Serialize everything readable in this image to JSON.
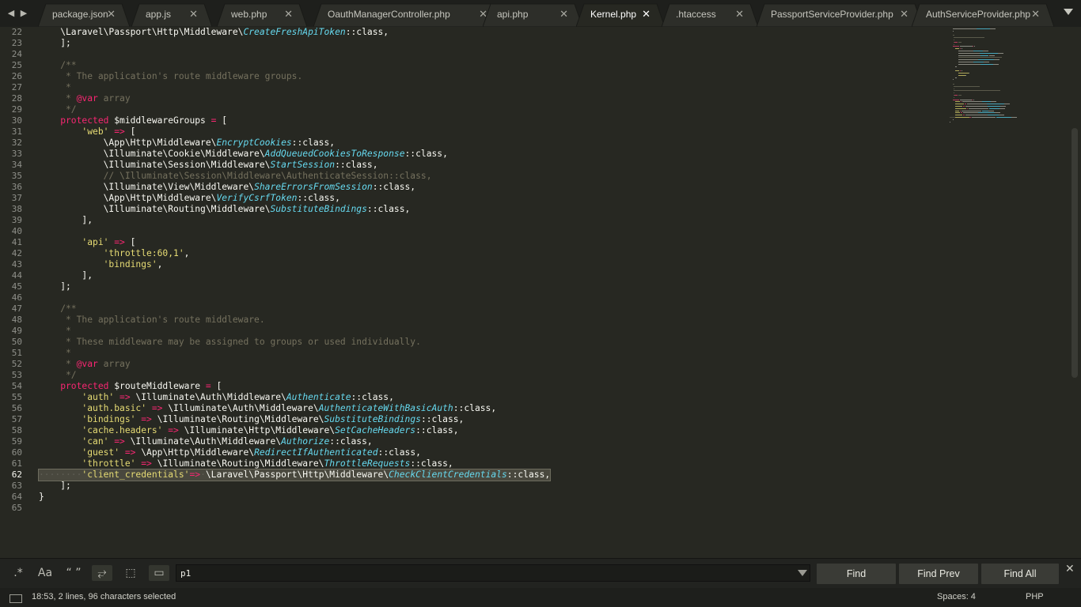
{
  "tabs": [
    {
      "label": "package.json",
      "active": false
    },
    {
      "label": "app.js",
      "active": false
    },
    {
      "label": "web.php",
      "active": false
    },
    {
      "label": "OauthManagerController.php",
      "active": false
    },
    {
      "label": "api.php",
      "active": false
    },
    {
      "label": "Kernel.php",
      "active": true
    },
    {
      "label": ".htaccess",
      "active": false
    },
    {
      "label": "PassportServiceProvider.php",
      "active": false
    },
    {
      "label": "AuthServiceProvider.php",
      "active": false
    }
  ],
  "tab_close_glyph": "✕",
  "nav_back_glyph": "◀",
  "nav_forward_glyph": "▶",
  "editor": {
    "first_line_number": 22,
    "current_line": 62,
    "selected_lines": [
      62
    ],
    "lines": [
      [
        [
          "",
          "    \\Laravel\\Passport\\Http\\Middleware\\"
        ],
        [
          "cl",
          "CreateFreshApiToken"
        ],
        [
          "",
          "::class,"
        ]
      ],
      [
        [
          "",
          "    ];"
        ]
      ],
      [
        [
          "",
          ""
        ]
      ],
      [
        [
          "cm",
          "    /**"
        ]
      ],
      [
        [
          "cm",
          "     * The application's route middleware groups."
        ]
      ],
      [
        [
          "cm",
          "     *"
        ]
      ],
      [
        [
          "cm",
          "     * "
        ],
        [
          "kw",
          "@var"
        ],
        [
          "cm",
          " array"
        ]
      ],
      [
        [
          "cm",
          "     */"
        ]
      ],
      [
        [
          "kw",
          "    protected"
        ],
        [
          "",
          " $middlewareGroups "
        ],
        [
          "kw",
          "="
        ],
        [
          "",
          " ["
        ]
      ],
      [
        [
          "st",
          "        'web'"
        ],
        [
          "kw",
          " =>"
        ],
        [
          "",
          " ["
        ]
      ],
      [
        [
          "",
          "            \\App\\Http\\Middleware\\"
        ],
        [
          "cl",
          "EncryptCookies"
        ],
        [
          "",
          "::class,"
        ]
      ],
      [
        [
          "",
          "            \\Illuminate\\Cookie\\Middleware\\"
        ],
        [
          "cl",
          "AddQueuedCookiesToResponse"
        ],
        [
          "",
          "::class,"
        ]
      ],
      [
        [
          "",
          "            \\Illuminate\\Session\\Middleware\\"
        ],
        [
          "cl",
          "StartSession"
        ],
        [
          "",
          "::class,"
        ]
      ],
      [
        [
          "cm",
          "            // \\Illuminate\\Session\\Middleware\\AuthenticateSession::class,"
        ]
      ],
      [
        [
          "",
          "            \\Illuminate\\View\\Middleware\\"
        ],
        [
          "cl",
          "ShareErrorsFromSession"
        ],
        [
          "",
          "::class,"
        ]
      ],
      [
        [
          "",
          "            \\App\\Http\\Middleware\\"
        ],
        [
          "cl",
          "VerifyCsrfToken"
        ],
        [
          "",
          "::class,"
        ]
      ],
      [
        [
          "",
          "            \\Illuminate\\Routing\\Middleware\\"
        ],
        [
          "cl",
          "SubstituteBindings"
        ],
        [
          "",
          "::class,"
        ]
      ],
      [
        [
          "",
          "        ],"
        ]
      ],
      [
        [
          "",
          ""
        ]
      ],
      [
        [
          "st",
          "        'api'"
        ],
        [
          "kw",
          " =>"
        ],
        [
          "",
          " ["
        ]
      ],
      [
        [
          "st",
          "            'throttle:60,1'"
        ],
        [
          "",
          ","
        ]
      ],
      [
        [
          "st",
          "            'bindings'"
        ],
        [
          "",
          ","
        ]
      ],
      [
        [
          "",
          "        ],"
        ]
      ],
      [
        [
          "",
          "    ];"
        ]
      ],
      [
        [
          "",
          ""
        ]
      ],
      [
        [
          "cm",
          "    /**"
        ]
      ],
      [
        [
          "cm",
          "     * The application's route middleware."
        ]
      ],
      [
        [
          "cm",
          "     *"
        ]
      ],
      [
        [
          "cm",
          "     * These middleware may be assigned to groups or used individually."
        ]
      ],
      [
        [
          "cm",
          "     *"
        ]
      ],
      [
        [
          "cm",
          "     * "
        ],
        [
          "kw",
          "@var"
        ],
        [
          "cm",
          " array"
        ]
      ],
      [
        [
          "cm",
          "     */"
        ]
      ],
      [
        [
          "kw",
          "    protected"
        ],
        [
          "",
          " $routeMiddleware "
        ],
        [
          "kw",
          "="
        ],
        [
          "",
          " ["
        ]
      ],
      [
        [
          "st",
          "        'auth'"
        ],
        [
          "kw",
          " =>"
        ],
        [
          "",
          " \\Illuminate\\Auth\\Middleware\\"
        ],
        [
          "cl",
          "Authenticate"
        ],
        [
          "",
          "::class,"
        ]
      ],
      [
        [
          "st",
          "        'auth.basic'"
        ],
        [
          "kw",
          " =>"
        ],
        [
          "",
          " \\Illuminate\\Auth\\Middleware\\"
        ],
        [
          "cl",
          "AuthenticateWithBasicAuth"
        ],
        [
          "",
          "::class,"
        ]
      ],
      [
        [
          "st",
          "        'bindings'"
        ],
        [
          "kw",
          " =>"
        ],
        [
          "",
          " \\Illuminate\\Routing\\Middleware\\"
        ],
        [
          "cl",
          "SubstituteBindings"
        ],
        [
          "",
          "::class,"
        ]
      ],
      [
        [
          "st",
          "        'cache.headers'"
        ],
        [
          "kw",
          " =>"
        ],
        [
          "",
          " \\Illuminate\\Http\\Middleware\\"
        ],
        [
          "cl",
          "SetCacheHeaders"
        ],
        [
          "",
          "::class,"
        ]
      ],
      [
        [
          "st",
          "        'can'"
        ],
        [
          "kw",
          " =>"
        ],
        [
          "",
          " \\Illuminate\\Auth\\Middleware\\"
        ],
        [
          "cl",
          "Authorize"
        ],
        [
          "",
          "::class,"
        ]
      ],
      [
        [
          "st",
          "        'guest'"
        ],
        [
          "kw",
          " =>"
        ],
        [
          "",
          " \\App\\Http\\Middleware\\"
        ],
        [
          "cl",
          "RedirectIfAuthenticated"
        ],
        [
          "",
          "::class,"
        ]
      ],
      [
        [
          "st",
          "        'throttle'"
        ],
        [
          "kw",
          " =>"
        ],
        [
          "",
          " \\Illuminate\\Routing\\Middleware\\"
        ],
        [
          "cl",
          "ThrottleRequests"
        ],
        [
          "",
          "::class,"
        ]
      ],
      [
        [
          "wt",
          "········"
        ],
        [
          "st",
          "'client_credentials'"
        ],
        [
          "kw",
          "=>"
        ],
        [
          "wt",
          "·"
        ],
        [
          "",
          "\\Laravel\\Passport\\Http\\Middleware\\"
        ],
        [
          "cl",
          "CheckClientCredentials"
        ],
        [
          "",
          "::class,"
        ]
      ],
      [
        [
          "",
          "    ];"
        ]
      ],
      [
        [
          "",
          "}"
        ]
      ],
      [
        [
          "",
          ""
        ]
      ]
    ]
  },
  "find_panel": {
    "options": [
      {
        "name": "regex-toggle",
        "glyph": ".*",
        "on": false
      },
      {
        "name": "case-sensitive-toggle",
        "glyph": "Aa",
        "on": false
      },
      {
        "name": "whole-word-toggle",
        "glyph": "“ ”",
        "on": false
      },
      {
        "name": "wrap-toggle",
        "glyph": "⥂",
        "on": true
      },
      {
        "name": "in-selection-toggle",
        "glyph": "⬚",
        "on": false
      },
      {
        "name": "highlight-matches-toggle",
        "glyph": "▭",
        "on": true
      }
    ],
    "query": "p1",
    "find_label": "Find",
    "find_prev_label": "Find Prev",
    "find_all_label": "Find All",
    "close_glyph": "✕"
  },
  "status": {
    "text": "18:53, 2 lines, 96 characters selected",
    "indent": "Spaces: 4",
    "syntax": "PHP"
  },
  "colors": {
    "background": "#272822",
    "comment": "#75715e",
    "keyword": "#f92672",
    "string": "#e6db74",
    "class": "#66d9ef",
    "text": "#f8f8f2"
  }
}
